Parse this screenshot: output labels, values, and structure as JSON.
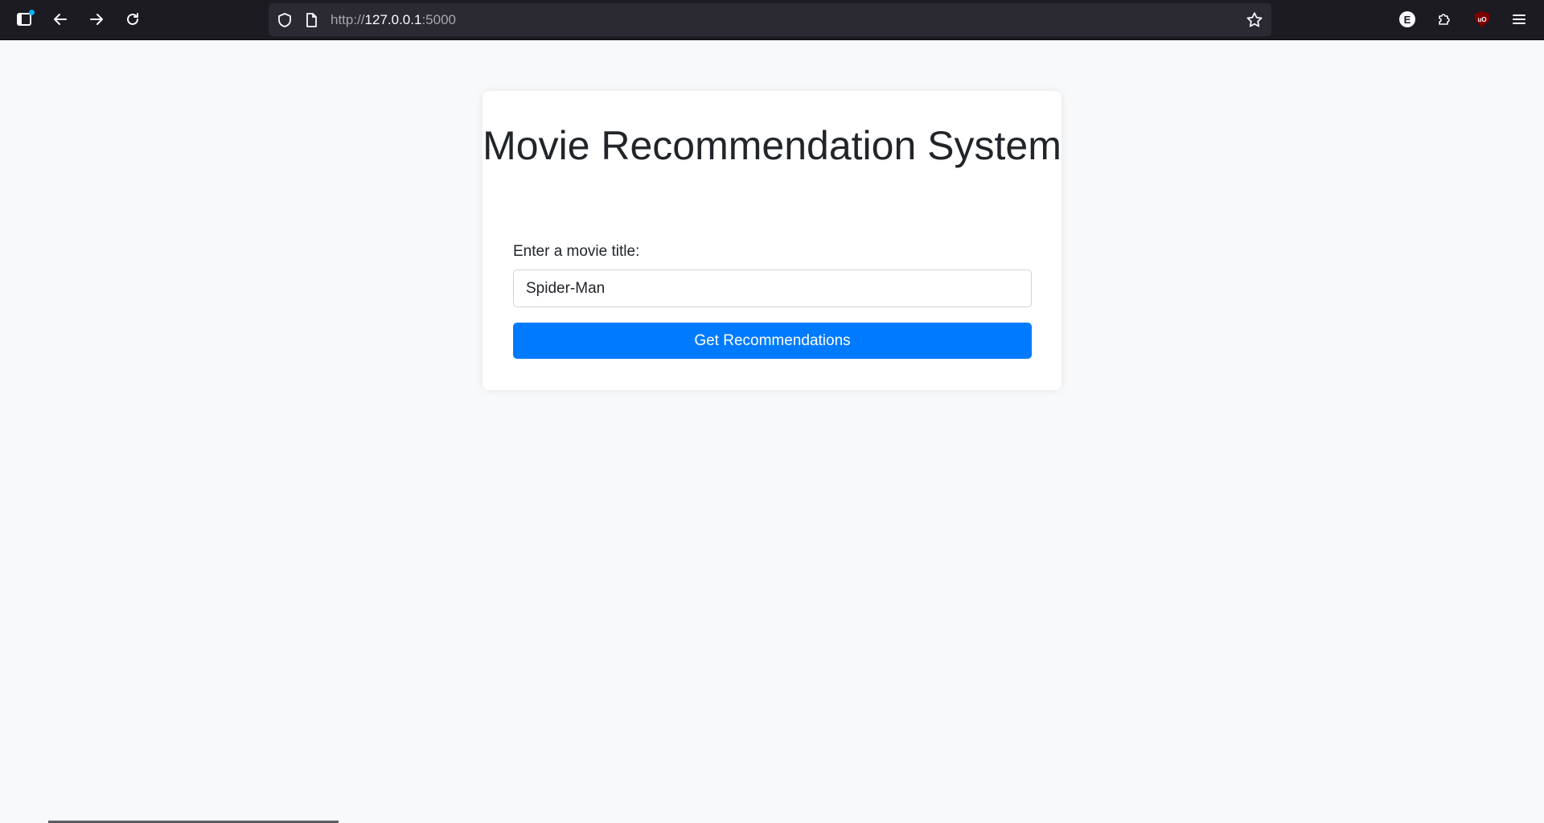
{
  "browser": {
    "url_prefix": "http://",
    "url_host": "127.0.0.1",
    "url_port": ":5000"
  },
  "page": {
    "title": "Movie Recommendation System",
    "label": "Enter a movie title:",
    "input_value": "Spider-Man",
    "button_label": "Get Recommendations"
  },
  "extensions": {
    "e_label": "E",
    "ublock_label": "uO"
  },
  "colors": {
    "accent": "#007bff",
    "chrome_bg": "#1c1b22",
    "page_bg": "#f8f9fa"
  }
}
